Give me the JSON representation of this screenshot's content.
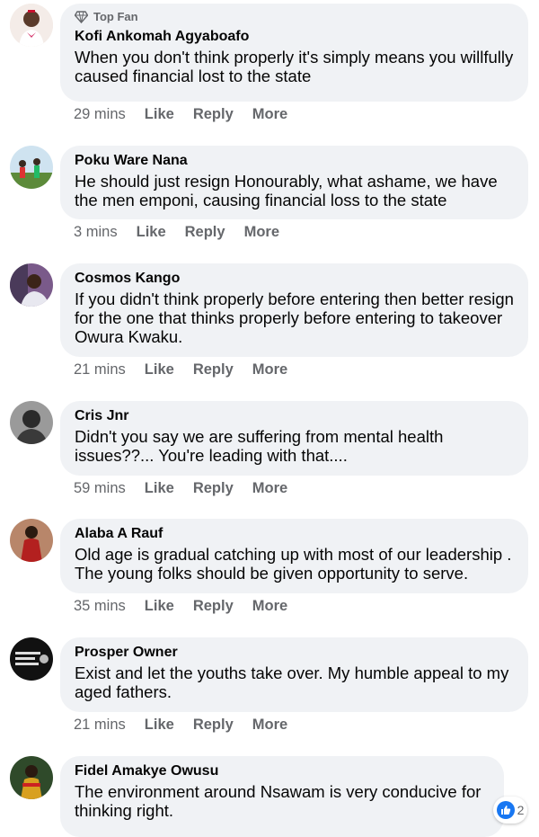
{
  "comments": [
    {
      "badge": "Top Fan",
      "author": "Kofi Ankomah Agyaboafo",
      "text": "When you don't think properly it's simply means you willfully caused financial lost to the state",
      "time": "29 mins",
      "like": "Like",
      "reply": "Reply",
      "more": "More"
    },
    {
      "author": "Poku Ware Nana",
      "text": "He should just resign Honourably, what ashame, we have the men emponi, causing financial loss to the state",
      "time": "3 mins",
      "like": "Like",
      "reply": "Reply",
      "more": "More"
    },
    {
      "author": "Cosmos Kango",
      "text": "If you didn't think properly before entering then better resign for the one that thinks properly before entering to takeover Owura Kwaku.",
      "time": "21 mins",
      "like": "Like",
      "reply": "Reply",
      "more": "More"
    },
    {
      "author": "Cris Jnr",
      "text": "Didn't you say we are suffering from mental health issues??... You're leading with that....",
      "time": "59 mins",
      "like": "Like",
      "reply": "Reply",
      "more": "More"
    },
    {
      "author": "Alaba A Rauf",
      "text": "Old age is gradual catching up with most of our leadership . The young folks should be given opportunity to serve.",
      "time": "35 mins",
      "like": "Like",
      "reply": "Reply",
      "more": "More"
    },
    {
      "author": "Prosper Owner",
      "text": "Exist and let the youths take over. My humble appeal to my aged fathers.",
      "time": "21 mins",
      "like": "Like",
      "reply": "Reply",
      "more": "More"
    },
    {
      "author": "Fidel Amakye Owusu",
      "text": "The environment around Nsawam is very conducive for thinking right.",
      "reaction_count": "2"
    }
  ],
  "colors": {
    "bubble": "#f0f2f5",
    "meta": "#65676b",
    "like_blue": "#1877f2"
  },
  "icons": {
    "badge": "diamond-icon",
    "reaction": "thumbs-up-icon"
  }
}
